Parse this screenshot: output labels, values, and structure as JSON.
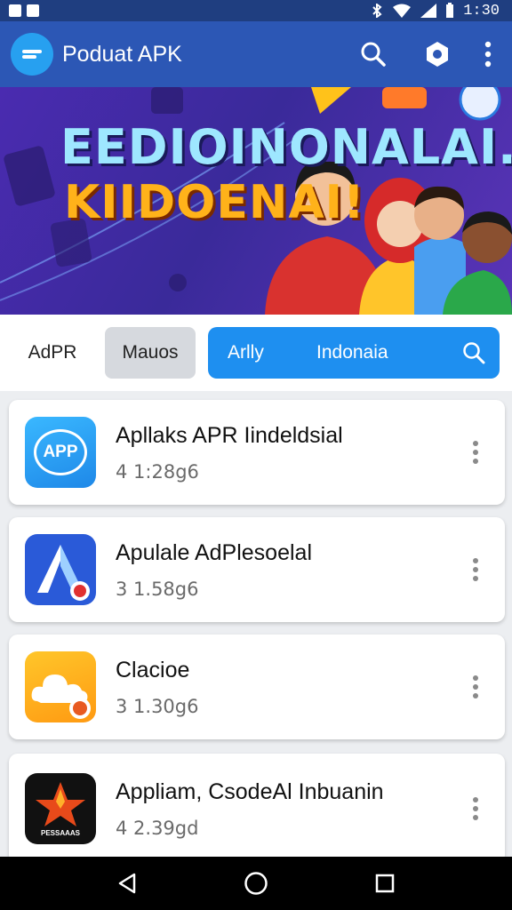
{
  "status_bar": {
    "time": "1:30"
  },
  "app_bar": {
    "title": "Poduat APK"
  },
  "banner": {
    "line1": "EEDIOINONALAI.",
    "line2": "KIIDOENAI!"
  },
  "filters": {
    "chip1": "AdPR",
    "chip2": "Mauos",
    "search_text1": "Arlly",
    "search_text2": "Indonaia"
  },
  "apps": [
    {
      "name": "Apllaks APR Iindeldsial",
      "size": "4 1:28g6"
    },
    {
      "name": "Apulale AdPlesoelal",
      "size": "3 1.58g6"
    },
    {
      "name": "Clacioe",
      "size": "3 1.30g6"
    },
    {
      "name": "Appliam, CsodeAl Inbuanin",
      "size": "4 2.39gd"
    }
  ],
  "icons": {
    "app1_label": "APP",
    "app4_label": "PESSAAAS"
  }
}
